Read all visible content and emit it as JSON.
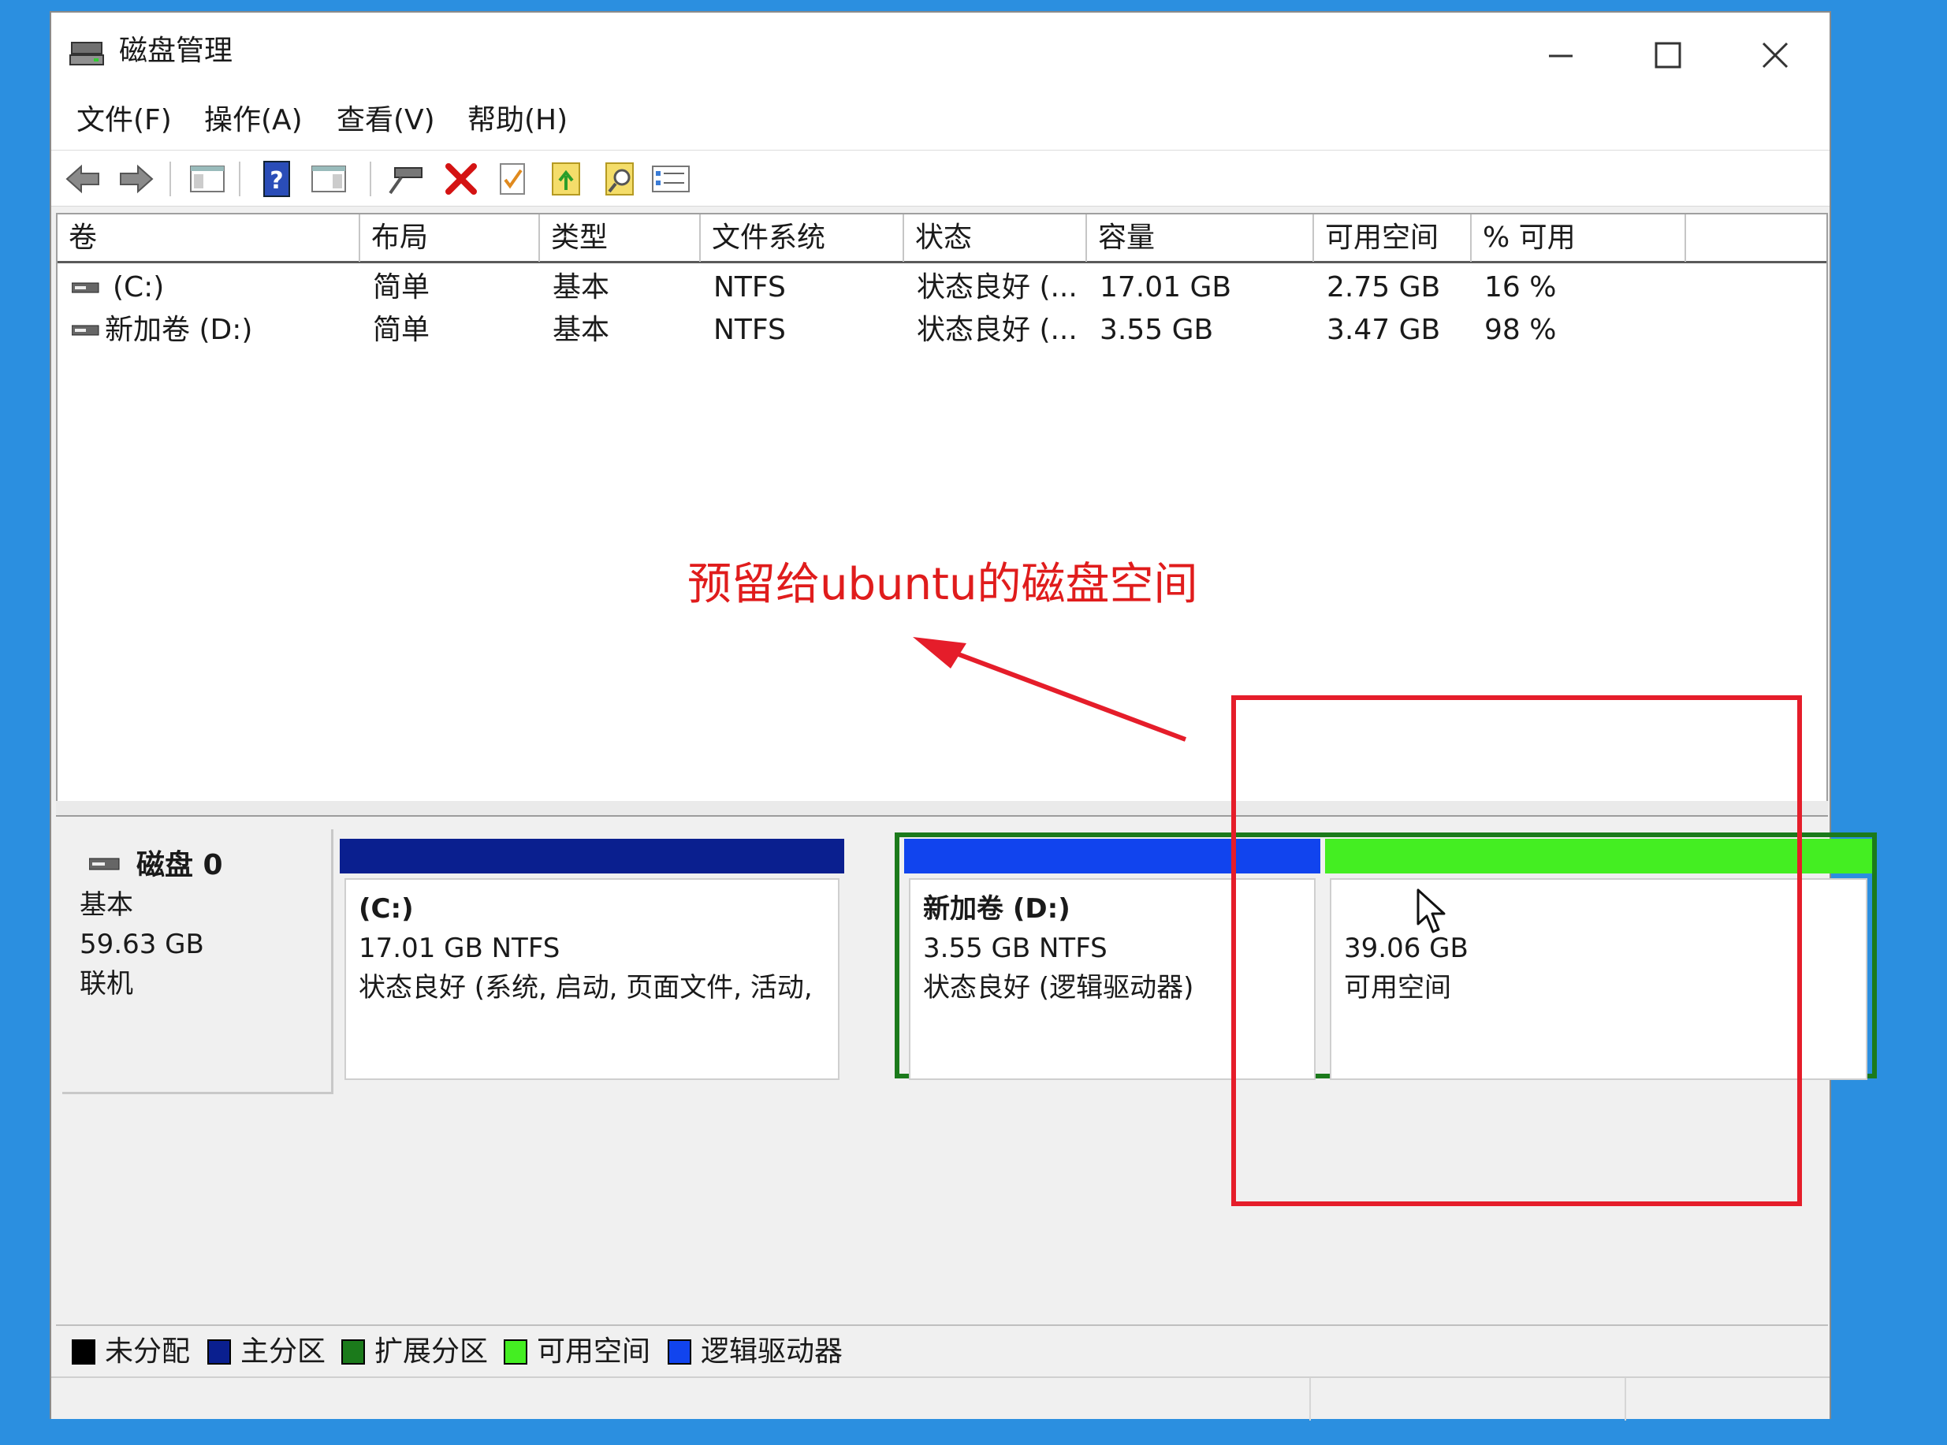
{
  "window": {
    "title": "磁盘管理"
  },
  "menu": [
    "文件(F)",
    "操作(A)",
    "查看(V)",
    "帮助(H)"
  ],
  "columns": [
    "卷",
    "布局",
    "类型",
    "文件系统",
    "状态",
    "容量",
    "可用空间",
    "% 可用"
  ],
  "volumes": [
    {
      "name": "(C:)",
      "layout": "简单",
      "type": "基本",
      "fs": "NTFS",
      "status": "状态良好 (...",
      "capacity": "17.01 GB",
      "free": "2.75 GB",
      "pct": "16 %"
    },
    {
      "name": "新加卷 (D:)",
      "layout": "简单",
      "type": "基本",
      "fs": "NTFS",
      "status": "状态良好 (...",
      "capacity": "3.55 GB",
      "free": "3.47 GB",
      "pct": "98 %"
    }
  ],
  "annotation": {
    "text": "预留给ubuntu的磁盘空间"
  },
  "disk": {
    "title": "磁盘 0",
    "type": "基本",
    "size": "59.63 GB",
    "state": "联机"
  },
  "partitions": [
    {
      "title": "(C:)",
      "size": "17.01 GB NTFS",
      "status": "状态良好 (系统, 启动, 页面文件, 活动,",
      "color": "#0a1f8f"
    },
    {
      "title": "新加卷 (D:)",
      "size": "3.55 GB NTFS",
      "status": "状态良好 (逻辑驱动器)",
      "color": "#1144ee"
    },
    {
      "size": "39.06 GB",
      "status": "可用空间",
      "color": "#44ee22"
    }
  ],
  "legend": [
    {
      "label": "未分配",
      "color": "#000000"
    },
    {
      "label": "主分区",
      "color": "#0a1f8f"
    },
    {
      "label": "扩展分区",
      "color": "#1b7a1b"
    },
    {
      "label": "可用空间",
      "color": "#44ee22"
    },
    {
      "label": "逻辑驱动器",
      "color": "#1144ee"
    }
  ],
  "colors": {
    "highlight": "#e51d2a",
    "extended_frame": "#1b7a1b"
  },
  "toolbar_icons": [
    "back-icon",
    "forward-icon",
    "show-hide-console-tree-icon",
    "help-icon",
    "show-hide-action-pane-icon",
    "connect-virtual-disk-icon",
    "delete-icon",
    "properties-icon",
    "export-list-icon",
    "search-icon",
    "settings-icon"
  ]
}
